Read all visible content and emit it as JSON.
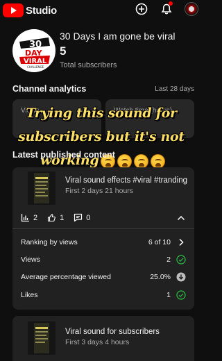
{
  "app": {
    "title": "Studio",
    "avatar_icon": "channel-avatar"
  },
  "channel": {
    "name": "30 Days I am gone be viral",
    "subscriber_count": "5",
    "subscriber_label": "Total subscribers",
    "logo_text": {
      "top": "30",
      "middle": "DAY",
      "bottom": "VIRAL",
      "tag": "CHALLENGE"
    }
  },
  "analytics": {
    "title": "Channel analytics",
    "range": "Last 28 days",
    "metrics": [
      {
        "label": "Views"
      },
      {
        "label": "Watch time (hours)"
      }
    ]
  },
  "overlay_caption": {
    "line1": "Trying this sound for",
    "line2": "subscribers but it's not",
    "line3": "working",
    "emoji": "weary-face",
    "emoji_count": 4
  },
  "latest": {
    "title": "Latest published content",
    "videos": [
      {
        "title": "Viral sound effects #viral #tranding",
        "date": "First 2 days 21 hours",
        "stats": {
          "analytics": "2",
          "likes": "1",
          "comments": "0"
        },
        "details": [
          {
            "label": "Ranking by views",
            "value": "6 of 10",
            "icon": "chevron-right"
          },
          {
            "label": "Views",
            "value": "2",
            "icon": "check-circle"
          },
          {
            "label": "Average percentage viewed",
            "value": "25.0%",
            "icon": "down-arrow-circle"
          },
          {
            "label": "Likes",
            "value": "1",
            "icon": "check-circle"
          }
        ]
      },
      {
        "title": "Viral sound for subscribers",
        "date": "First 3 days 4 hours"
      }
    ]
  },
  "colors": {
    "background": "#0f0f0f",
    "card": "#212121",
    "accent_red": "#ff0000",
    "success_green": "#2ba640",
    "caption_yellow": "#ffe066"
  }
}
